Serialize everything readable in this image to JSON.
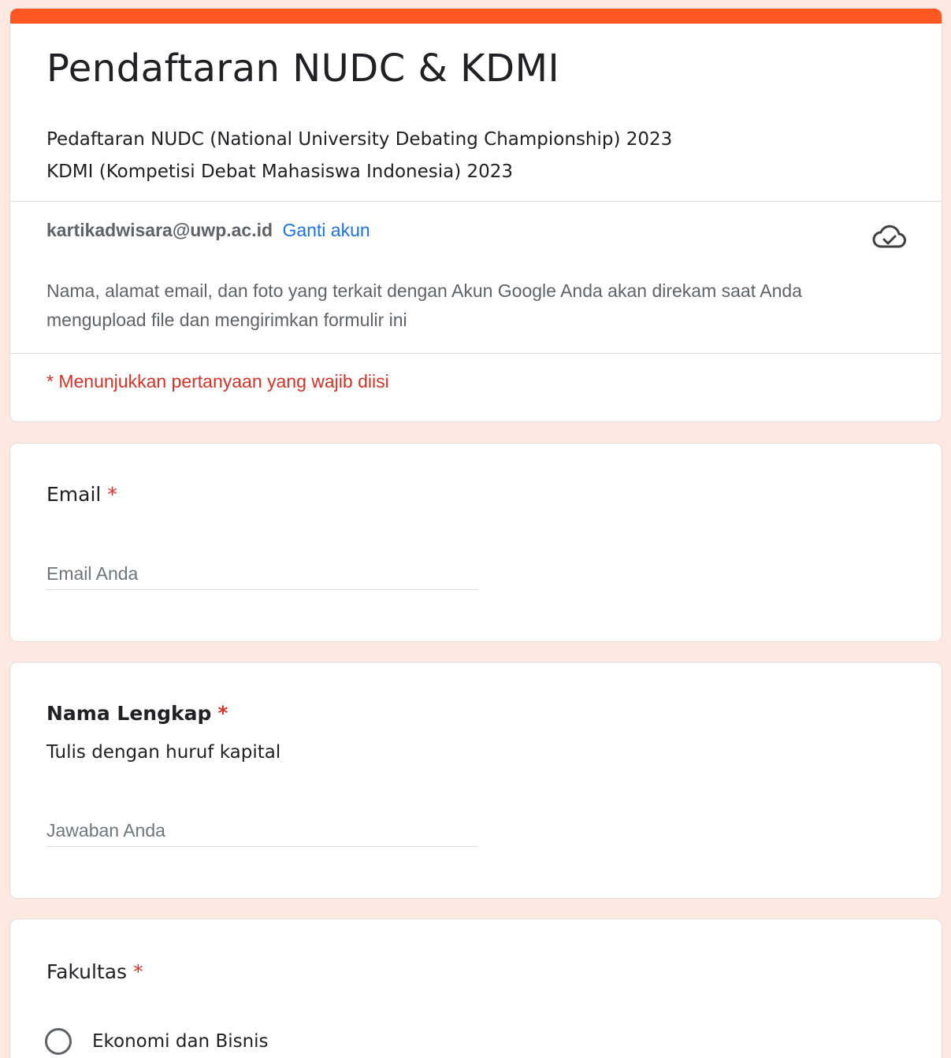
{
  "header": {
    "title": "Pendaftaran NUDC & KDMI",
    "description_lines": [
      "Pedaftaran NUDC (National University Debating Championship) 2023",
      "KDMI (Kompetisi Debat Mahasiswa Indonesia) 2023"
    ],
    "accent_color": "#ff5722"
  },
  "account": {
    "email": "kartikadwisara@uwp.ac.id",
    "switch_label": "Ganti akun",
    "cloud_icon": "cloud-check-icon",
    "notice": "Nama, alamat email, dan foto yang terkait dengan Akun Google Anda akan direkam saat Anda mengupload file dan mengirimkan formulir ini"
  },
  "required_note": "* Menunjukkan pertanyaan yang wajib diisi",
  "questions": [
    {
      "title": "Email",
      "required_mark": "*",
      "placeholder": "Email Anda"
    },
    {
      "title": "Nama Lengkap",
      "required_mark": "*",
      "help": "Tulis dengan huruf kapital",
      "placeholder": "Jawaban Anda"
    },
    {
      "title": "Fakultas",
      "required_mark": "*",
      "options": [
        "Ekonomi dan Bisnis"
      ]
    }
  ],
  "colors": {
    "background": "#fde9e1",
    "required": "#d93025",
    "link": "#1a73e8"
  }
}
